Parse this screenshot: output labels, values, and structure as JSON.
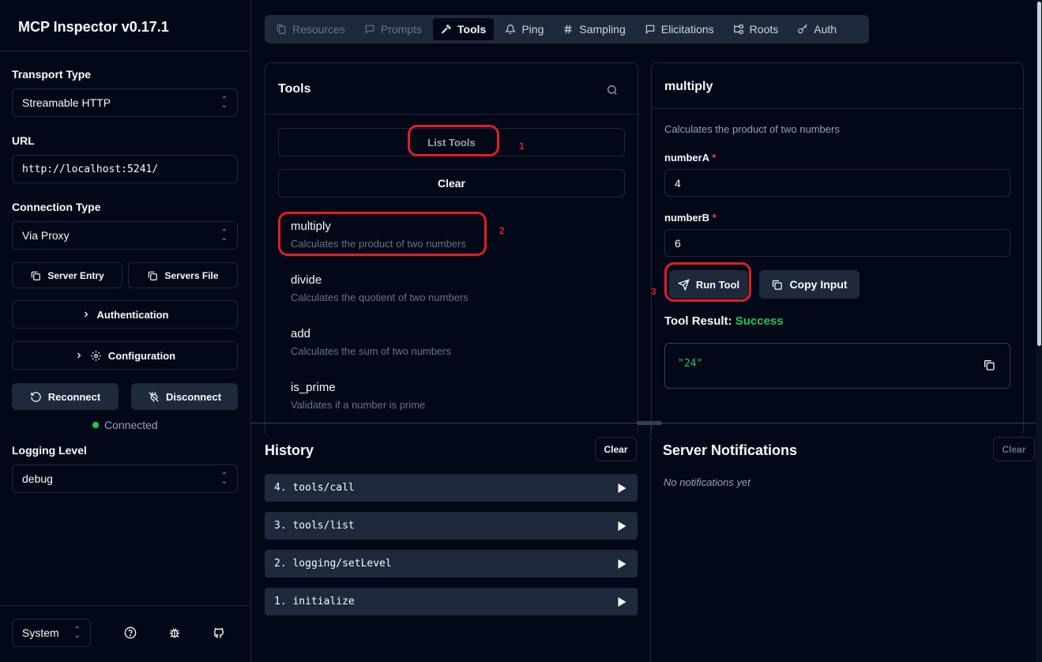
{
  "app": {
    "title": "MCP Inspector v0.17.1"
  },
  "sidebar": {
    "transport_label": "Transport Type",
    "transport_value": "Streamable HTTP",
    "url_label": "URL",
    "url_value": "http://localhost:5241/",
    "connection_label": "Connection Type",
    "connection_value": "Via Proxy",
    "server_entry": "Server Entry",
    "servers_file": "Servers File",
    "authentication": "Authentication",
    "configuration": "Configuration",
    "reconnect": "Reconnect",
    "disconnect": "Disconnect",
    "status": "Connected",
    "logging_label": "Logging Level",
    "logging_value": "debug",
    "theme_value": "System"
  },
  "tabs": [
    {
      "label": "Resources",
      "icon": "files-icon"
    },
    {
      "label": "Prompts",
      "icon": "message-icon"
    },
    {
      "label": "Tools",
      "icon": "hammer-icon"
    },
    {
      "label": "Ping",
      "icon": "bell-icon"
    },
    {
      "label": "Sampling",
      "icon": "hash-icon"
    },
    {
      "label": "Elicitations",
      "icon": "message-icon"
    },
    {
      "label": "Roots",
      "icon": "tree-icon"
    },
    {
      "label": "Auth",
      "icon": "key-icon"
    }
  ],
  "tools_panel": {
    "title": "Tools",
    "list_tools": "List Tools",
    "clear": "Clear",
    "items": [
      {
        "name": "multiply",
        "desc": "Calculates the product of two numbers"
      },
      {
        "name": "divide",
        "desc": "Calculates the quotient of two numbers"
      },
      {
        "name": "add",
        "desc": "Calculates the sum of two numbers"
      },
      {
        "name": "is_prime",
        "desc": "Validates if a number is prime"
      }
    ]
  },
  "detail_panel": {
    "title": "multiply",
    "desc": "Calculates the product of two numbers",
    "field_a_label": "numberA",
    "field_a_value": "4",
    "field_b_label": "numberB",
    "field_b_value": "6",
    "required_mark": "*",
    "run_tool": "Run Tool",
    "copy_input": "Copy Input",
    "result_label": "Tool Result:",
    "result_status": "Success",
    "result_value": "\"24\""
  },
  "annotations": {
    "n1": "1",
    "n2": "2",
    "n3": "3"
  },
  "history": {
    "title": "History",
    "clear": "Clear",
    "items": [
      "4. tools/call",
      "3. tools/list",
      "2. logging/setLevel",
      "1. initialize"
    ]
  },
  "notifications": {
    "title": "Server Notifications",
    "clear": "Clear",
    "empty": "No notifications yet"
  },
  "colors": {
    "background": "#020817",
    "border": "#1e293b",
    "success": "#22c55e",
    "required": "#ef4444",
    "annotation_red": "#e11d2a"
  }
}
